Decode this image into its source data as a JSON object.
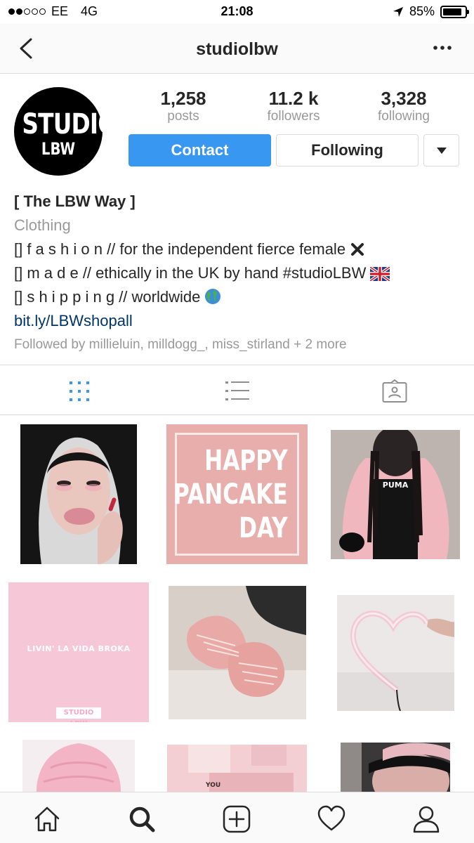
{
  "status_bar": {
    "carrier": "EE",
    "network": "4G",
    "time": "21:08",
    "battery": "85%",
    "battery_level": 0.85
  },
  "header": {
    "username": "studiolbw",
    "back_icon": "chevron-left-icon",
    "more_icon": "more-horizontal-icon"
  },
  "profile": {
    "avatar_line1": "STUDIO",
    "avatar_line2": "LBW",
    "stats": [
      {
        "value": "1,258",
        "label": "posts"
      },
      {
        "value": "11.2 k",
        "label": "followers"
      },
      {
        "value": "3,328",
        "label": "following"
      }
    ],
    "contact_label": "Contact",
    "following_label": "Following"
  },
  "bio": {
    "name": "[ The LBW Way ]",
    "category": "Clothing",
    "lines": [
      "[] f a s h i o n // for the independent fierce female",
      "[] m a d e // ethically in the UK by hand #studioLBW",
      "[] s h i p p i n g // worldwide"
    ],
    "link": "bit.ly/LBWshopall",
    "followed_by": "Followed by millieluin, milldogg_, miss_stirland + 2 more"
  },
  "tabs": [
    "grid-icon",
    "list-icon",
    "tagged-icon"
  ],
  "grid": {
    "happy_lines": [
      "HAPPY",
      "PANCAKE",
      "DAY"
    ],
    "vida_text": "LIVIN' LA VIDA BROKA",
    "vida_brand": "STUDIO LBW",
    "puma_text": "PUMA",
    "you_text": "YOU"
  },
  "bottom_nav": [
    "home-icon",
    "search-icon",
    "add-icon",
    "heart-icon",
    "profile-icon"
  ],
  "colors": {
    "accent_blue": "#3897f0",
    "link": "#003569",
    "muted": "#999999",
    "pink_tile": "#f6c8d7"
  }
}
